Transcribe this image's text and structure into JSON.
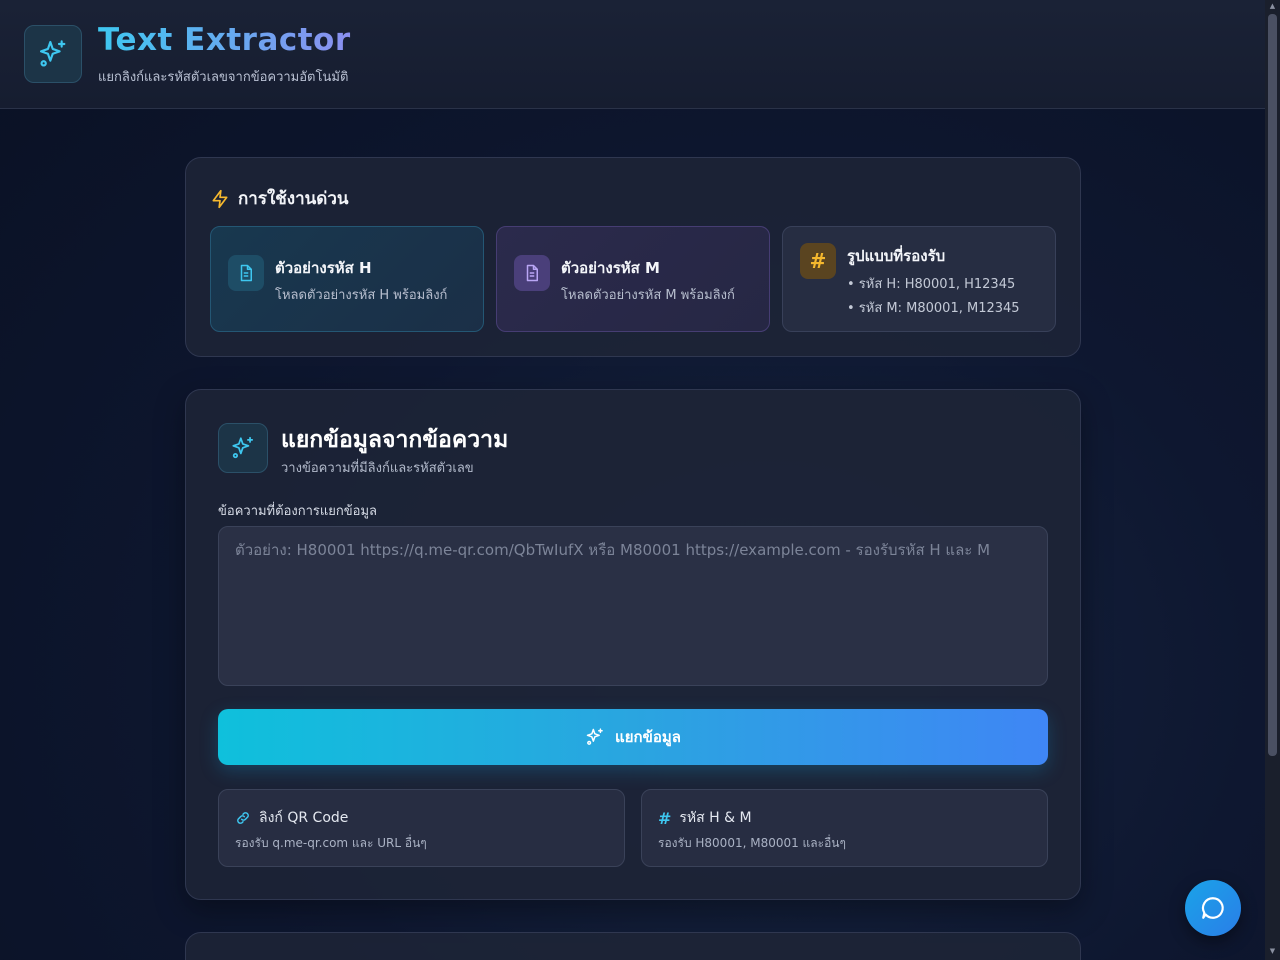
{
  "header": {
    "title": "Text Extractor",
    "subtitle": "แยกลิงก์และรหัสตัวเลขจากข้อความอัตโนมัติ"
  },
  "quick": {
    "title": "การใช้งานด่วน",
    "cards": [
      {
        "title": "ตัวอย่างรหัส H",
        "desc": "โหลดตัวอย่างรหัส H พร้อมลิงก์"
      },
      {
        "title": "ตัวอย่างรหัส M",
        "desc": "โหลดตัวอย่างรหัส M พร้อมลิงก์"
      }
    ],
    "formats": {
      "icon": "#",
      "title": "รูปแบบที่รองรับ",
      "lines": [
        "• รหัส H: H80001, H12345",
        "• รหัส M: M80001, M12345"
      ]
    }
  },
  "extractor": {
    "title": "แยกข้อมูลจากข้อความ",
    "subtitle": "วางข้อความที่มีลิงก์และรหัสตัวเลข",
    "field_label": "ข้อความที่ต้องการแยกข้อมูล",
    "input_value": "",
    "placeholder": "ตัวอย่าง: H80001 https://q.me-qr.com/QbTwIufX หรือ M80001 https://example.com - รองรับรหัส H และ M",
    "button_label": "แยกข้อมูล",
    "info": [
      {
        "icon": "link-icon",
        "title": "ลิงก์ QR Code",
        "desc": "รองรับ q.me-qr.com และ URL อื่นๆ"
      },
      {
        "icon": "hash-icon",
        "title": "รหัส H & M",
        "desc": "รองรับ H80001, M80001 และอื่นๆ"
      }
    ]
  },
  "colors": {
    "accent_cyan": "#0fc0dc",
    "accent_blue": "#3f86f5",
    "accent_yellow": "#f5b82e",
    "accent_purple": "#8b8ff0"
  }
}
